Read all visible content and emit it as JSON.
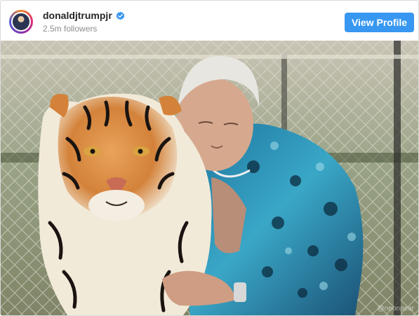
{
  "header": {
    "username": "donaldjtrumpjr",
    "followers": "2.5m followers",
    "view_profile_label": "View Profile",
    "verified_icon": "verified-badge-icon",
    "accent_color": "#3897f0"
  },
  "post": {
    "watermark": "@neonpear"
  }
}
